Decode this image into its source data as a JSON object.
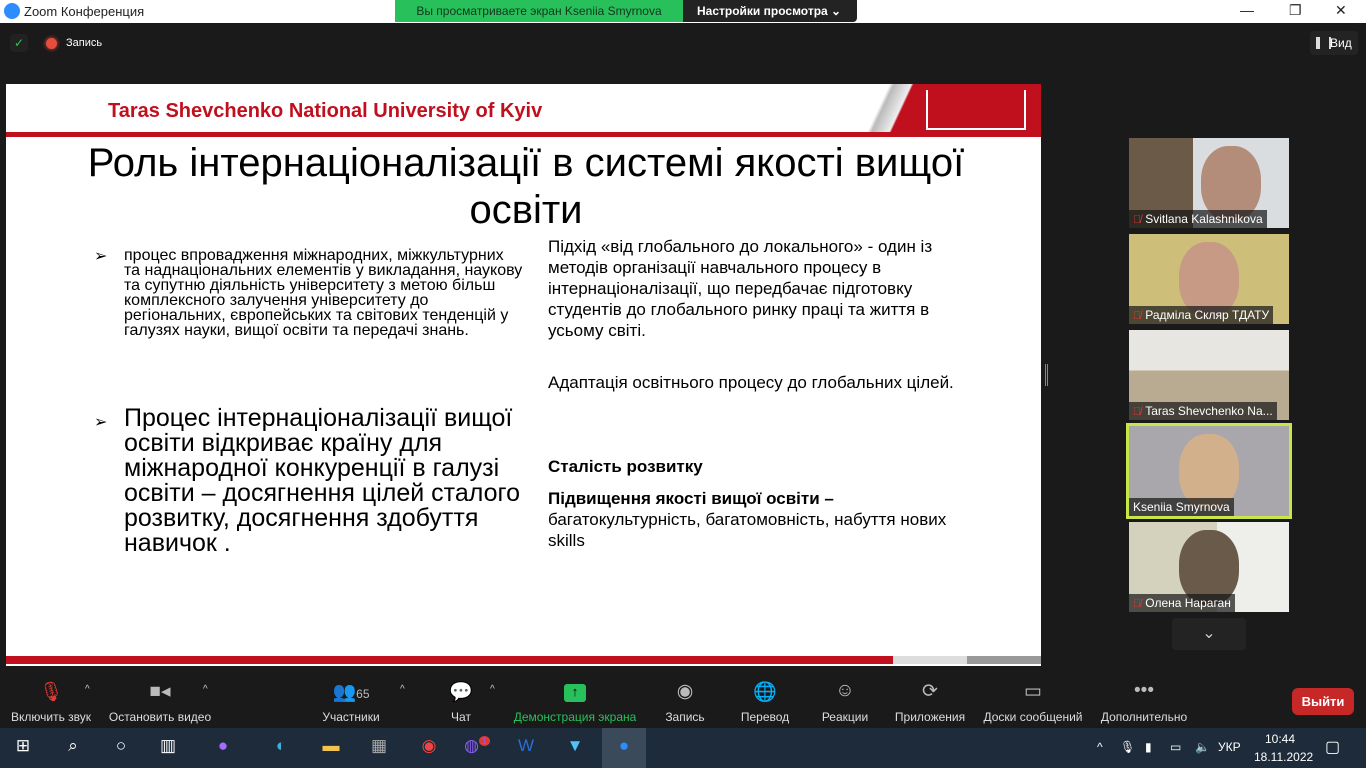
{
  "window": {
    "title": "Zoom Конференция",
    "controls": [
      "—",
      "❐",
      "✕"
    ]
  },
  "share_banner": {
    "viewing": "Вы просматриваете экран Kseniia Smyrnova",
    "view_options": "Настройки просмотра ⌄"
  },
  "topbar": {
    "record_label": "Запись",
    "view_label": "Вид"
  },
  "slide": {
    "header": "Taras Shevchenko National University of Kyiv",
    "title": "Роль інтернаціоналізації в системі якості вищої освіти",
    "bullet1": "процес впровадження міжнародних, міжкультурних та наднаціональних елементів у викладання, наукову та супутню діяльність університету з метою більш комплексного залучення університету до регіональних, європейських та світових тенденцій у галузях науки, вищої освіти та передачі знань.",
    "bullet2": "Процес інтернаціоналізації вищої освіти відкриває країну для міжнародної конкуренції в галузі освіти – досягнення цілей сталого розвитку, досягнення здобуття навичок .",
    "bullet_glyph": "➢",
    "right_p1": "Підхід «від глобального до локального» - один із методів організації навчального процесу в інтернаціоналізації, що передбачає підготовку студентів до глобального ринку праці та життя в усьому світі.",
    "right_p2": "Адаптація освітнього процесу до глобальних цілей.",
    "right_h1": "Сталість розвитку",
    "right_h2": "Підвищення якості вищої освіти –",
    "right_p3": "багатокультурність, багатомовність, набуття нових skills"
  },
  "participants": [
    {
      "name": "Svitlana Kalashnikova",
      "muted": true
    },
    {
      "name": "Радміла Скляр ТДАТУ",
      "muted": true
    },
    {
      "name": "Taras Shevchenko Na...",
      "muted": true
    },
    {
      "name": "Kseniia Smyrnova",
      "muted": false,
      "active": true
    },
    {
      "name": "Олена Нараган",
      "muted": true
    }
  ],
  "toolbar": {
    "unmute": "Включить звук",
    "stop_video": "Остановить видео",
    "participants": "Участники",
    "participants_count": "65",
    "chat": "Чат",
    "share": "Демонстрация экрана",
    "record": "Запись",
    "translate": "Перевод",
    "reactions": "Реакции",
    "apps": "Приложения",
    "whiteboards": "Доски сообщений",
    "more": "Дополнительно",
    "leave": "Выйти"
  },
  "taskbar": {
    "lang": "УКР",
    "time": "10:44",
    "date": "18.11.2022",
    "viber_badge": "1"
  },
  "colors": {
    "accent_red": "#c0101e",
    "zoom_green": "#27c05a",
    "leave_red": "#c62828",
    "active_speaker": "#c8e64a"
  }
}
